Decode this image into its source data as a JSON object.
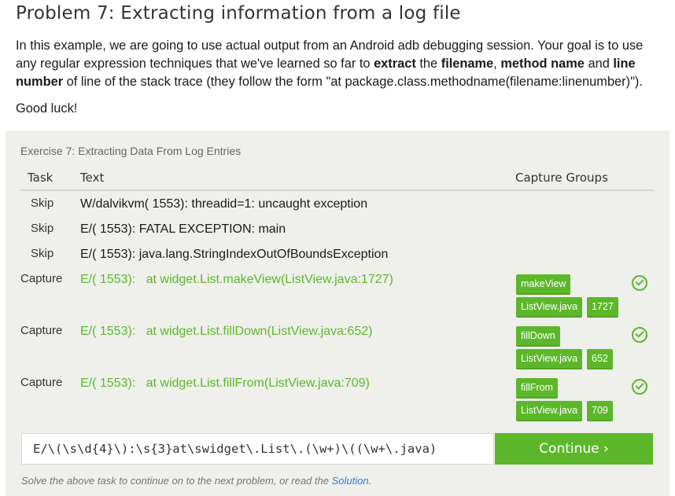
{
  "problem": {
    "title": "Problem 7: Extracting information from a log file",
    "intro": {
      "p1": "In this example, we are going to use actual output from an Android adb debugging session. Your goal is to use any regular expression techniques that we've learned so far to ",
      "b1": "extract",
      "p2": " the ",
      "b2": "filename",
      "p3": ", ",
      "b3": "method name",
      "p4": " and ",
      "b4": "line number",
      "p5": " of line of the stack trace (they follow the form \"at package.class.methodname(filename:linenumber)\")."
    },
    "good_luck": "Good luck!"
  },
  "exercise": {
    "title": "Exercise 7: Extracting Data From Log Entries",
    "headers": {
      "task": "Task",
      "text": "Text",
      "groups": "Capture Groups"
    },
    "rows": [
      {
        "task": "Skip",
        "text": "W/dalvikvm( 1553): threadid=1: uncaught exception"
      },
      {
        "task": "Skip",
        "text": "E/( 1553): FATAL EXCEPTION: main"
      },
      {
        "task": "Skip",
        "text": "E/( 1553): java.lang.StringIndexOutOfBoundsException"
      },
      {
        "task": "Capture",
        "text": "E/( 1553):   at widget.List.makeView(ListView.java:1727)",
        "groups": [
          "makeView",
          "ListView.java",
          "1727"
        ]
      },
      {
        "task": "Capture",
        "text": "E/( 1553):   at widget.List.fillDown(ListView.java:652)",
        "groups": [
          "fillDown",
          "ListView.java",
          "652"
        ]
      },
      {
        "task": "Capture",
        "text": "E/( 1553):   at widget.List.fillFrom(ListView.java:709)",
        "groups": [
          "fillFrom",
          "ListView.java",
          "709"
        ]
      }
    ],
    "regex_value": "E/\\(\\s\\d{4}\\):\\s{3}at\\swidget\\.List\\.(\\w+)\\((\\w+\\.java)",
    "continue_label": "Continue ›",
    "footer_text": "Solve the above task to continue on to the next problem, or read the ",
    "footer_link": "Solution",
    "footer_end": "."
  },
  "colors": {
    "accent": "#5cb82a",
    "panel": "#efefec",
    "link": "#2a7fd4"
  },
  "icons": {
    "check": "check-circle-icon"
  }
}
